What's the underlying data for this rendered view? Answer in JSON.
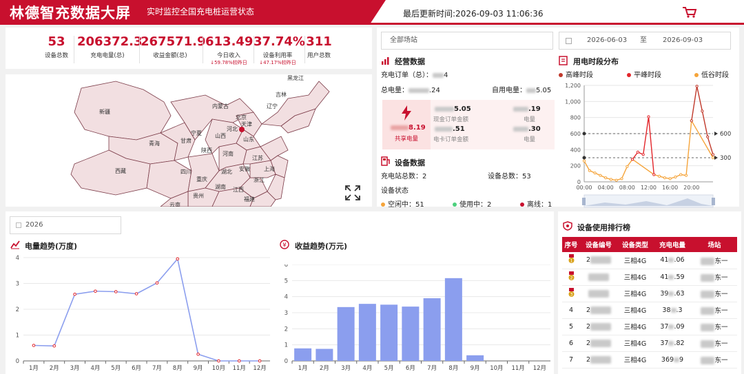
{
  "header": {
    "title": "林德智充数据大屏",
    "subtitle": "实时监控全国充电桩运营状态",
    "update_label": "最后更新时间:",
    "update_time": "2026-09-03 11:06:36",
    "cart_icon": "cart-icon"
  },
  "stats": [
    {
      "value": "53",
      "label": "设备总数",
      "compare": ""
    },
    {
      "value": "206372.3",
      "label": "充电电量(总)",
      "compare": ""
    },
    {
      "value": "267571.9",
      "label": "收益金额(总)",
      "compare": ""
    },
    {
      "value": "613.49",
      "label": "今日收入",
      "compare": "↓59.78%较昨日"
    },
    {
      "value": "37.74%",
      "label": "设备利用率",
      "compare": "↓47.17%较昨日"
    },
    {
      "value": "311",
      "label": "用户总数",
      "compare": ""
    }
  ],
  "map": {
    "provinces": [
      "黑龙江",
      "吉林",
      "辽宁",
      "内蒙古",
      "北京",
      "天津",
      "河北",
      "山西",
      "宁夏",
      "甘肃",
      "新疆",
      "青海",
      "陕西",
      "山东",
      "河南",
      "江苏",
      "西藏",
      "四川",
      "重庆",
      "湖北",
      "安徽",
      "上海",
      "浙江",
      "湖南",
      "江西",
      "贵州",
      "福建",
      "云南"
    ]
  },
  "filters": {
    "station_placeholder": "全部场站",
    "date_start": "2026-06-03",
    "date_sep": "至",
    "date_end": "2026-09-03"
  },
  "operations": {
    "title": "经营数据",
    "orders_label": "充电订单（总）：",
    "orders_value_tail": "4",
    "total_power_label": "总电量：",
    "total_power_tail": ".24",
    "self_power_label": "自用电量：",
    "self_power_tail": "5.05",
    "shared_value_tail": "8.19",
    "shared_label": "共享电量",
    "cash_value_tail": "5.05",
    "cash_label": "现金订单金额",
    "cash_power_tail": ".19",
    "cash_power_label": "电量",
    "card_value_tail": ".51",
    "card_label": "电卡订单金额",
    "card_power_tail": ".30",
    "card_power_label": "电量"
  },
  "devices": {
    "title": "设备数据",
    "stations_label": "充电站总数：",
    "stations_value": "2",
    "devices_label": "设备总数：",
    "devices_value": "53",
    "status_title": "设备状态",
    "idle_label": "空闲中：",
    "idle_value": "51",
    "inuse_label": "使用中：",
    "inuse_value": "2",
    "offline_label": "离线：",
    "offline_value": "1"
  },
  "time_chart": {
    "title": "用电时段分布",
    "legend": [
      {
        "name": "高峰时段",
        "color": "#c0392b"
      },
      {
        "name": "平峰时段",
        "color": "#e3262b"
      },
      {
        "name": "低谷时段",
        "color": "#f5a43a"
      }
    ],
    "chart_data": {
      "type": "line",
      "x_ticks": [
        "00:00",
        "04:00",
        "08:00",
        "12:00",
        "16:00",
        "20:00"
      ],
      "y_ticks": [
        "0",
        "200",
        "400",
        "600",
        "800",
        "1,000",
        "1,200"
      ],
      "ylim": [
        0,
        1200
      ],
      "markers": [
        600,
        300
      ],
      "marker_labels": [
        "600",
        "300"
      ],
      "valley": {
        "x": [
          0,
          1,
          2,
          3,
          4,
          5,
          6,
          7,
          8,
          9,
          13,
          14,
          15,
          16,
          17,
          18,
          19,
          20,
          24
        ],
        "y": [
          260,
          140,
          110,
          80,
          50,
          30,
          20,
          40,
          190,
          280,
          90,
          70,
          50,
          40,
          60,
          90,
          80,
          760,
          300
        ]
      },
      "flat": {
        "x": [
          9,
          10,
          11,
          12,
          13
        ],
        "y": [
          280,
          370,
          340,
          810,
          90
        ]
      },
      "peak": {
        "x": [
          20,
          21,
          22,
          23,
          24
        ],
        "y": [
          760,
          1190,
          880,
          560,
          340
        ]
      }
    }
  },
  "bottom": {
    "year": "2026",
    "power_title": "电量趋势(万度)",
    "income_title": "收益趋势(万元)",
    "months": [
      "1月",
      "2月",
      "3月",
      "4月",
      "5月",
      "6月",
      "7月",
      "8月",
      "9月",
      "10月",
      "11月",
      "12月"
    ]
  },
  "power_chart": {
    "chart_data": {
      "type": "line",
      "categories": [
        "1月",
        "2月",
        "3月",
        "4月",
        "5月",
        "6月",
        "7月",
        "8月",
        "9月",
        "10月",
        "11月",
        "12月"
      ],
      "values": [
        0.6,
        0.58,
        2.58,
        2.7,
        2.68,
        2.6,
        3.02,
        3.95,
        0.26,
        0,
        0,
        0
      ],
      "y_ticks": [
        "0",
        "1",
        "2",
        "3",
        "4"
      ],
      "ylim": [
        0,
        4
      ]
    }
  },
  "income_chart": {
    "chart_data": {
      "type": "bar",
      "categories": [
        "1月",
        "2月",
        "3月",
        "4月",
        "5月",
        "6月",
        "7月",
        "8月",
        "9月",
        "10月",
        "11月",
        "12月"
      ],
      "values": [
        0.78,
        0.75,
        3.35,
        3.55,
        3.5,
        3.38,
        3.9,
        5.15,
        0.35,
        0,
        0,
        0
      ],
      "y_ticks": [
        "0",
        "1",
        "2",
        "3",
        "4",
        "5",
        "6"
      ],
      "ylim": [
        0,
        6
      ]
    }
  },
  "ranking": {
    "title": "设备使用排行榜",
    "columns": [
      "序号",
      "设备编号",
      "设备类型",
      "充电电量",
      "场站"
    ],
    "rows": [
      {
        "rank": "1",
        "id": "2",
        "type": "三相4G",
        "power": "41900.06",
        "power_head": "41",
        "power_tail": ".06",
        "station": "东一"
      },
      {
        "rank": "2",
        "id": "",
        "type": "三相4G",
        "power_head": "41",
        "power_tail": ".59",
        "station": "东一"
      },
      {
        "rank": "3",
        "id": "",
        "type": "三相4G",
        "power_head": "39",
        "power_tail": ".63",
        "station": "东一"
      },
      {
        "rank": "4",
        "id": "2",
        "type": "三相4G",
        "power_head": "38",
        "power_tail": ".3",
        "station": "东一"
      },
      {
        "rank": "5",
        "id": "2",
        "type": "三相4G",
        "power_head": "37",
        "power_tail": ".09",
        "station": "东一"
      },
      {
        "rank": "6",
        "id": "2",
        "type": "三相4G",
        "power_head": "37",
        "power_tail": ".82",
        "station": "东一"
      },
      {
        "rank": "7",
        "id": "2",
        "type": "三相4G",
        "power_head": "369",
        "power_tail": "9",
        "station": "东一"
      }
    ]
  },
  "colors": {
    "brand": "#c8102e",
    "chart_blue": "#8b9eee"
  }
}
